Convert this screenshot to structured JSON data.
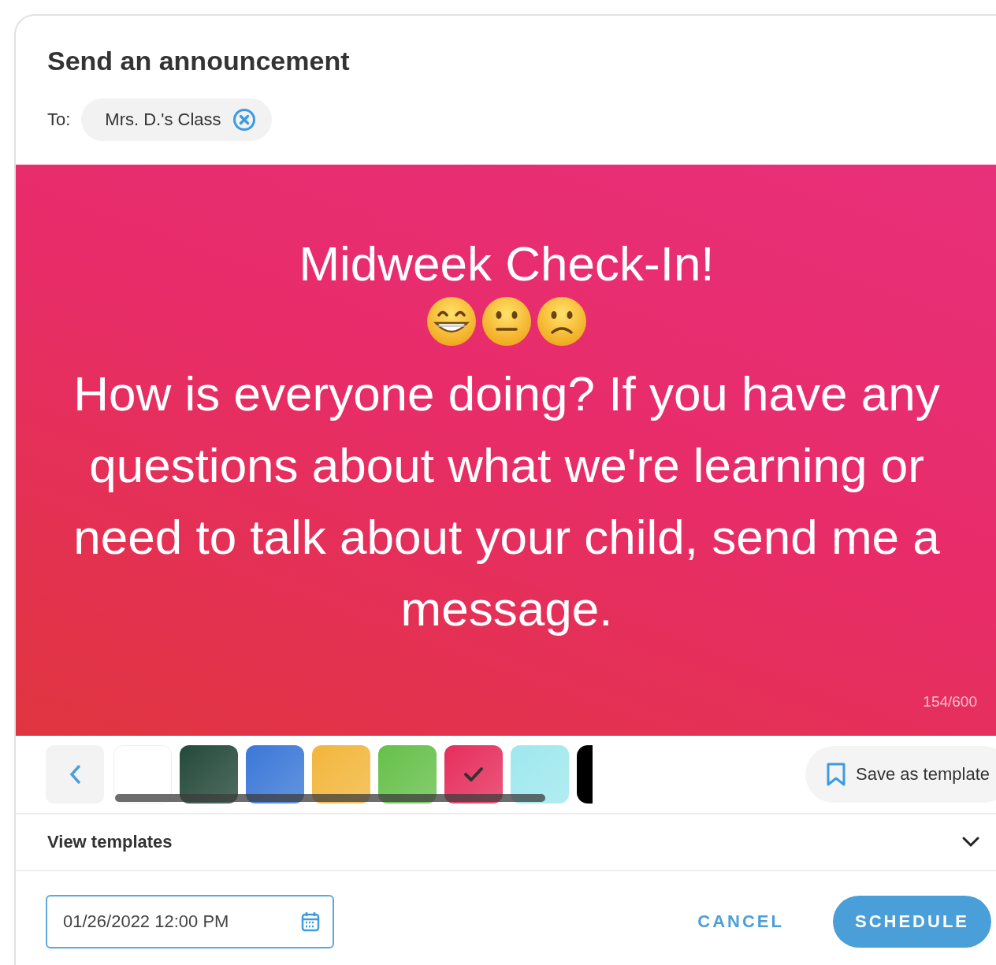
{
  "dialog": {
    "title": "Send an announcement"
  },
  "recipients": {
    "label": "To:",
    "chips": [
      {
        "name": "Mrs. D.'s Class"
      }
    ]
  },
  "message": {
    "heading": "Midweek Check-In!",
    "emojis": [
      {
        "kind": "grinning"
      },
      {
        "kind": "neutral"
      },
      {
        "kind": "frowning"
      }
    ],
    "body": "How is everyone doing? If you have any questions about what we're learning or need to talk about your child, send me a message.",
    "counter": "154/600"
  },
  "backgrounds": [
    {
      "kind": "plain",
      "color": "#ffffff",
      "selected": false
    },
    {
      "kind": "plain",
      "color": "#24493a",
      "selected": false
    },
    {
      "kind": "plain",
      "color": "#3b78d8",
      "selected": false
    },
    {
      "kind": "plain",
      "color": "#f2b63c",
      "selected": false
    },
    {
      "kind": "plain",
      "color": "#66c04a",
      "selected": false
    },
    {
      "kind": "plain",
      "color": "#e62e5c",
      "selected": true
    },
    {
      "kind": "plain",
      "color": "#9ee8ee",
      "selected": false
    },
    {
      "kind": "partial",
      "color": "#000000",
      "selected": false
    }
  ],
  "save_template": {
    "label": "Save as template"
  },
  "templates": {
    "label": "View templates",
    "expanded": false
  },
  "footer": {
    "date": "01/26/2022 12:00 PM",
    "cancel": "CANCEL",
    "schedule": "SCHEDULE"
  }
}
